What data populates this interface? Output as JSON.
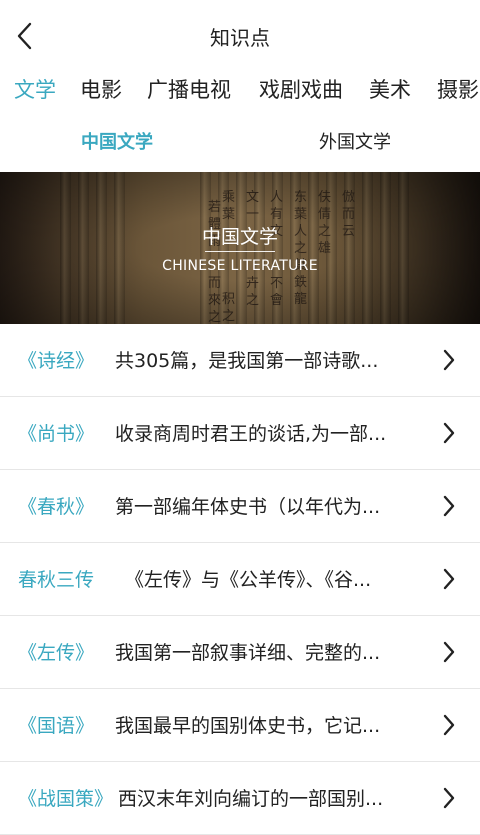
{
  "header": {
    "title": "知识点"
  },
  "categories": [
    {
      "label": "文学",
      "active": true
    },
    {
      "label": "电影",
      "active": false
    },
    {
      "label": "广播电视",
      "active": false
    },
    {
      "label": "戏剧戏曲",
      "active": false
    },
    {
      "label": "美术",
      "active": false
    },
    {
      "label": "摄影",
      "active": false
    }
  ],
  "subtabs": [
    {
      "label": "中国文学",
      "active": true
    },
    {
      "label": "外国文学",
      "active": false
    }
  ],
  "banner": {
    "title": "中国文学",
    "subtitle": "CHINESE LITERATURE",
    "scroll_chars": [
      "伕",
      "倩",
      "之",
      "雄",
      "倣",
      "而",
      "云",
      "东",
      "葉",
      "人",
      "之",
      "其",
      "鉄",
      "龍",
      "人",
      "有",
      "文",
      "不",
      "會",
      "文",
      "一",
      "卉",
      "之",
      "乘",
      "葉",
      "积",
      "之",
      "若",
      "體",
      "雨",
      "而",
      "來",
      "之"
    ]
  },
  "items": [
    {
      "name": "《诗经》",
      "desc": "共305篇，是我国第一部诗歌..."
    },
    {
      "name": "《尚书》",
      "desc": "收录商周时君王的谈话,为一部..."
    },
    {
      "name": "《春秋》",
      "desc": "第一部编年体史书（以年代为..."
    },
    {
      "name": "春秋三传",
      "desc": "《左传》与《公羊传》、《谷..."
    },
    {
      "name": "《左传》",
      "desc": "我国第一部叙事详细、完整的..."
    },
    {
      "name": "《国语》",
      "desc": "我国最早的国别体史书，它记..."
    },
    {
      "name": "《战国策》",
      "desc": "西汉末年刘向编订的一部国别..."
    }
  ],
  "colors": {
    "accent": "#3aa8c0",
    "text": "#222222",
    "divider": "#e6e6e6"
  },
  "icons": {
    "back": "chevron-left-icon",
    "row_arrow": "chevron-right-icon"
  }
}
